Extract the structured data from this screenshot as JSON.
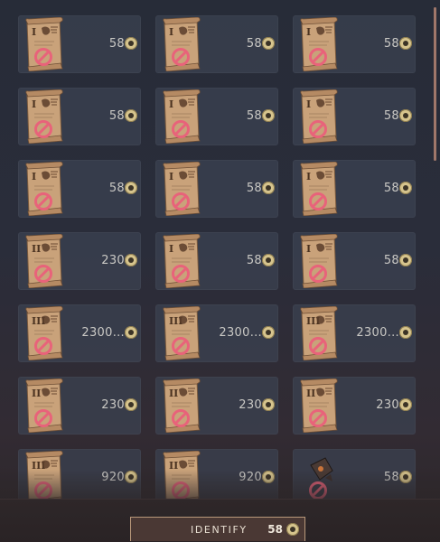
{
  "colors": {
    "slot_bg": "#3c4252",
    "scroll_paper": "#c9a27a",
    "forbidden_mark": "#e8637a",
    "coin": "#d6c48d",
    "button_border": "#b9987a"
  },
  "icons": {
    "scroll": "parchment-scroll-icon",
    "relic": "dark-relic-icon",
    "forbidden": "prohibited-icon",
    "coin": "coin-icon"
  },
  "items": [
    {
      "rank": "I",
      "price": "58",
      "icon": "scroll"
    },
    {
      "rank": "I",
      "price": "58",
      "icon": "scroll"
    },
    {
      "rank": "I",
      "price": "58",
      "icon": "scroll"
    },
    {
      "rank": "I",
      "price": "58",
      "icon": "scroll"
    },
    {
      "rank": "I",
      "price": "58",
      "icon": "scroll"
    },
    {
      "rank": "I",
      "price": "58",
      "icon": "scroll"
    },
    {
      "rank": "I",
      "price": "58",
      "icon": "scroll"
    },
    {
      "rank": "I",
      "price": "58",
      "icon": "scroll"
    },
    {
      "rank": "I",
      "price": "58",
      "icon": "scroll"
    },
    {
      "rank": "II",
      "price": "230",
      "icon": "scroll"
    },
    {
      "rank": "I",
      "price": "58",
      "icon": "scroll"
    },
    {
      "rank": "I",
      "price": "58",
      "icon": "scroll"
    },
    {
      "rank": "III",
      "price": "2300...",
      "icon": "scroll"
    },
    {
      "rank": "III",
      "price": "2300...",
      "icon": "scroll"
    },
    {
      "rank": "III",
      "price": "2300...",
      "icon": "scroll"
    },
    {
      "rank": "II",
      "price": "230",
      "icon": "scroll"
    },
    {
      "rank": "II",
      "price": "230",
      "icon": "scroll"
    },
    {
      "rank": "II",
      "price": "230",
      "icon": "scroll"
    },
    {
      "rank": "III",
      "price": "920",
      "icon": "scroll"
    },
    {
      "rank": "II",
      "price": "920",
      "icon": "scroll"
    },
    {
      "rank": "",
      "price": "58",
      "icon": "relic"
    }
  ],
  "identify": {
    "label": "IDENTIFY",
    "cost": "58"
  }
}
